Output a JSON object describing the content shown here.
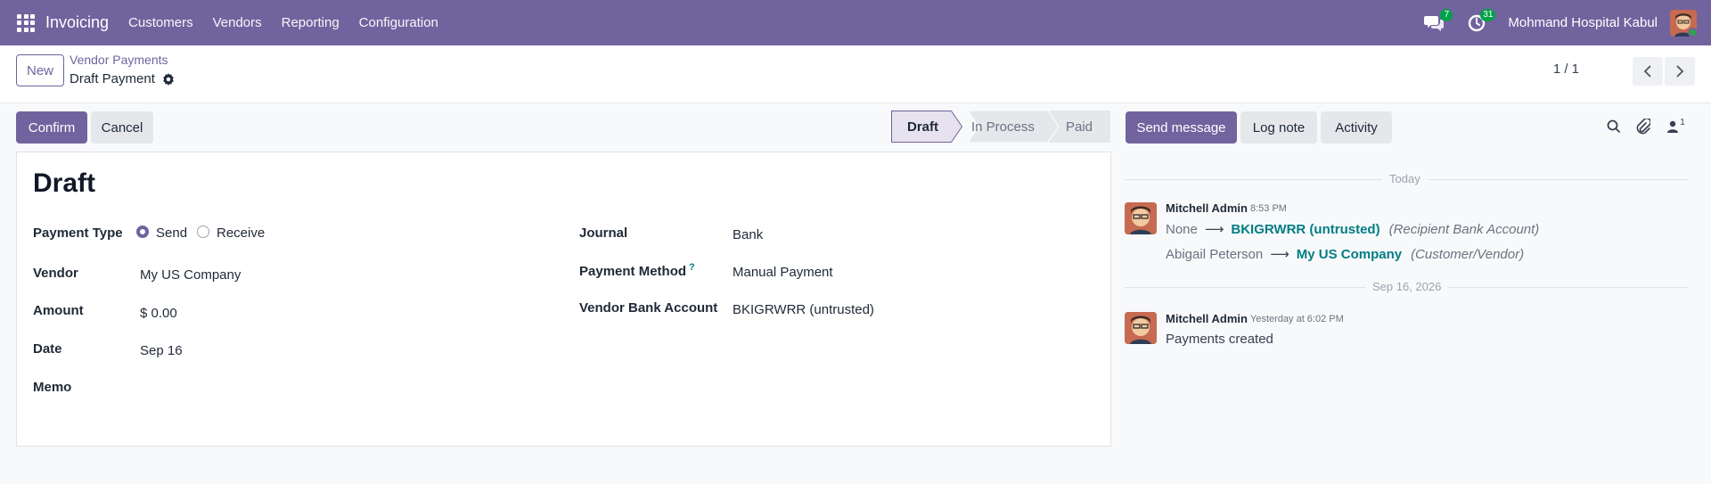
{
  "navbar": {
    "app_name": "Invoicing",
    "menus": [
      "Customers",
      "Vendors",
      "Reporting",
      "Configuration"
    ],
    "messages_count": "7",
    "activities_count": "31",
    "company": "Mohmand Hospital Kabul"
  },
  "control": {
    "new_label": "New",
    "breadcrumb_parent": "Vendor Payments",
    "breadcrumb_current": "Draft Payment",
    "pager": "1 / 1"
  },
  "actions": {
    "confirm_label": "Confirm",
    "cancel_label": "Cancel"
  },
  "status": {
    "stages": [
      "Draft",
      "In Process",
      "Paid"
    ],
    "active": "Draft"
  },
  "form": {
    "title": "Draft",
    "payment_type_label": "Payment Type",
    "payment_type_options": [
      "Send",
      "Receive"
    ],
    "payment_type_selected": "Send",
    "vendor_label": "Vendor",
    "vendor_value": "My US Company",
    "amount_label": "Amount",
    "amount_value": "$ 0.00",
    "date_label": "Date",
    "date_value": "Sep 16",
    "memo_label": "Memo",
    "memo_value": "",
    "journal_label": "Journal",
    "journal_value": "Bank",
    "payment_method_label": "Payment Method",
    "payment_method_help": "?",
    "payment_method_value": "Manual Payment",
    "vendor_bank_label": "Vendor Bank Account",
    "vendor_bank_value": "BKIGRWRR (untrusted)"
  },
  "chatter": {
    "send_message_label": "Send message",
    "log_note_label": "Log note",
    "activity_label": "Activity",
    "followers_count": "1",
    "separators": [
      "Today",
      "Sep 16, 2026"
    ],
    "messages": [
      {
        "author": "Mitchell Admin",
        "time": "8:53 PM",
        "tracking": [
          {
            "old": "None",
            "new": "BKIGRWRR (untrusted)",
            "field": "(Recipient Bank Account)"
          },
          {
            "old": "Abigail Peterson",
            "new": "My US Company",
            "field": "(Customer/Vendor)"
          }
        ]
      },
      {
        "author": "Mitchell Admin",
        "time": "Yesterday at 6:02 PM",
        "body": "Payments created"
      }
    ]
  },
  "colors": {
    "brand": "#71639e",
    "link": "#017e84",
    "badge": "#00a04a"
  }
}
